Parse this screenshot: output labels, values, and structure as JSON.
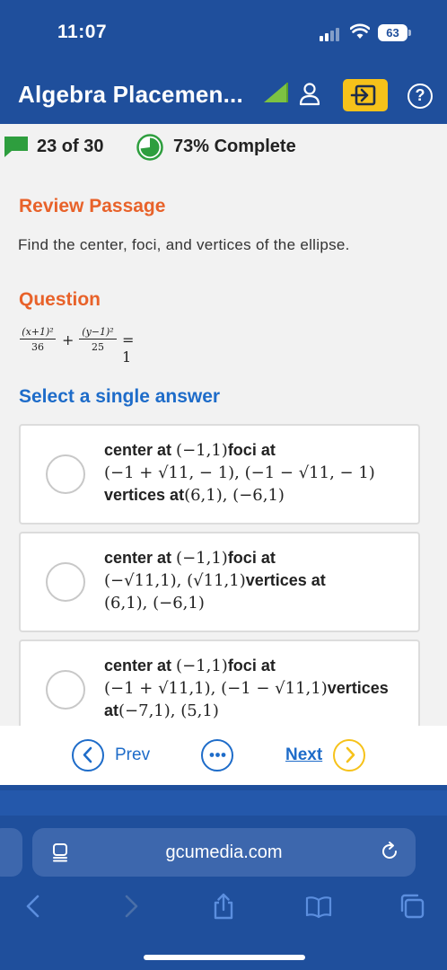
{
  "status_bar": {
    "time": "11:07",
    "battery": "63"
  },
  "header": {
    "title": "Algebra Placemen..."
  },
  "progress": {
    "count": "23 of 30",
    "percent_label": "73% Complete",
    "percent_value": 0.73
  },
  "review": {
    "title": "Review Passage",
    "passage": "Find the center, foci, and vertices of the ellipse."
  },
  "question": {
    "title": "Question",
    "frac1_num": "(x+1)²",
    "frac1_den": "36",
    "plus": "+",
    "frac2_num": "(y−1)²",
    "frac2_den": "25",
    "rhs": "= 1"
  },
  "answers": {
    "title": "Select a single answer",
    "options": [
      {
        "p1": "center at ",
        "m1": "(−1,1)",
        "p2": "foci at",
        "m2": "(−1 + √11, − 1), (−1 − √11, − 1)",
        "p3": "vertices at",
        "m3": "(6,1), (−6,1)"
      },
      {
        "p1": "center at ",
        "m1": "(−1,1)",
        "p2": "foci at",
        "m2": "(−√11,1), (√11,1)",
        "p3": "vertices at",
        "m3": "(6,1), (−6,1)"
      },
      {
        "p1": "center at ",
        "m1": "(−1,1)",
        "p2": "foci at",
        "m2": "(−1 + √11,1), (−1 − √11,1)",
        "p3": "vertices",
        "p4": "at",
        "m3": "(−7,1), (5,1)"
      }
    ]
  },
  "nav": {
    "prev": "Prev",
    "next": "Next"
  },
  "browser": {
    "url": "gcumedia.com"
  },
  "colors": {
    "header_blue": "#1f4f9c",
    "accent_orange": "#e8622a",
    "link_blue": "#1e6cc9",
    "yellow": "#f6c21a"
  }
}
